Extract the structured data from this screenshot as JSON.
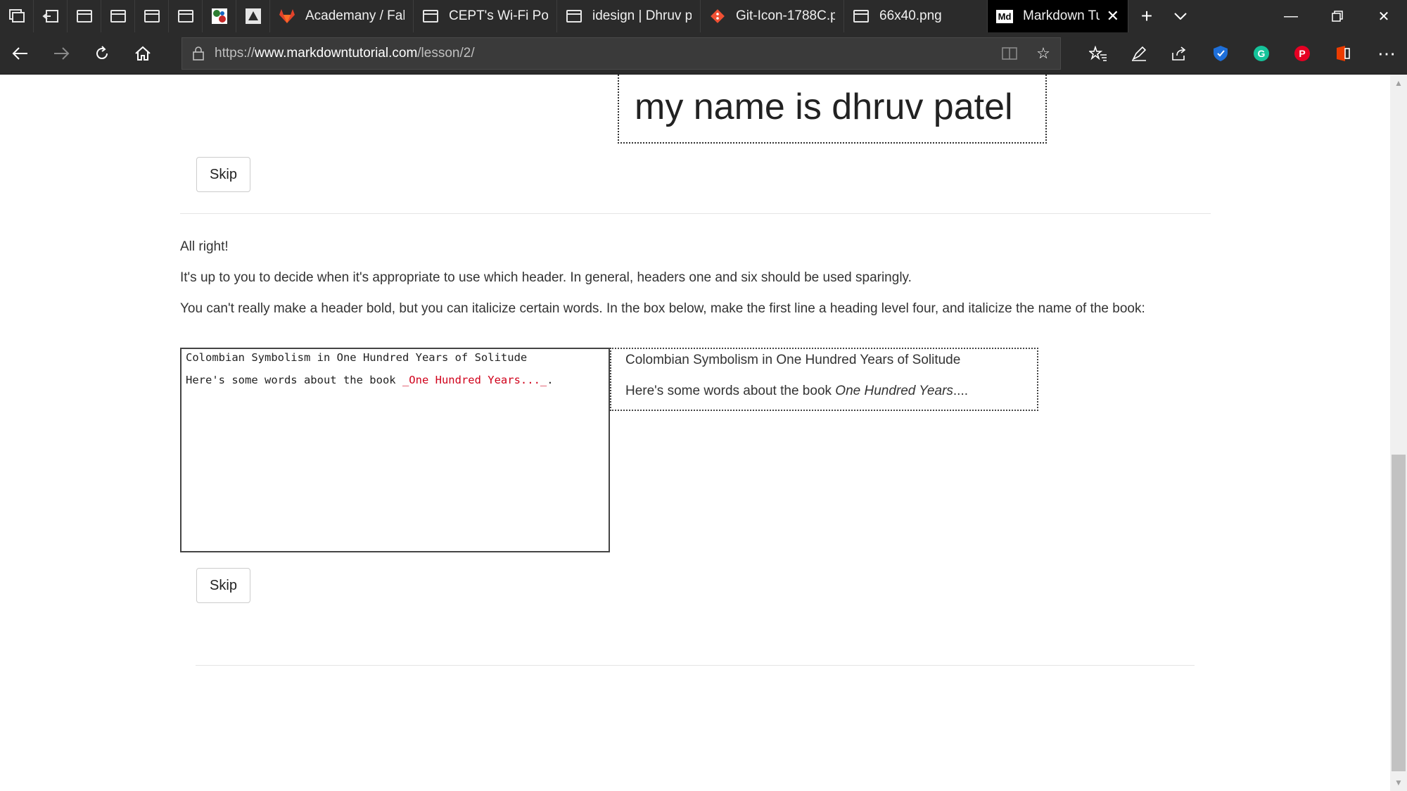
{
  "browser": {
    "tabs": [
      {
        "label": "Academany / Fab",
        "icon": "gitlab-icon",
        "active": false
      },
      {
        "label": "CEPT's Wi-Fi Port",
        "icon": "page-icon",
        "active": false
      },
      {
        "label": "idesign | Dhruv p",
        "icon": "page-icon",
        "active": false
      },
      {
        "label": "Git-Icon-1788C.p",
        "icon": "git-icon",
        "active": false
      },
      {
        "label": "66x40.png",
        "icon": "page-icon",
        "active": false
      },
      {
        "label": "Markdown Tu",
        "icon": "markdown-icon",
        "active": true
      }
    ],
    "markdown_favicon_text": "Md",
    "url_prefix": "https://",
    "url_host": "www.markdowntutorial.com",
    "url_path": "/lesson/2/",
    "accent_colors": {
      "gitlab": "#e2432a",
      "git": "#f05033",
      "grammarly": "#15c39a",
      "pinterest": "#e60023"
    }
  },
  "lesson": {
    "previous_result_text": "my name is dhruv patel",
    "skip_label_1": "Skip",
    "intro": "All right!",
    "paragraph_1": "It's up to you to decide when it's appropriate to use which header. In general, headers one and six should be used sparingly.",
    "paragraph_2": "You can't really make a header bold, but you can italicize certain words. In the box below, make the first line a heading level four, and italicize the name of the book:",
    "editor": {
      "line_1": "Colombian Symbolism in One Hundred Years of Solitude",
      "line_2_prefix": "Here's some words about the book ",
      "line_2_emphasis": "_One Hundred Years..._",
      "line_2_suffix": "."
    },
    "preview": {
      "line_1": "Colombian Symbolism in One Hundred Years of Solitude",
      "line_2_prefix": "Here's some words about the book ",
      "line_2_emphasis": "One Hundred Years",
      "line_2_suffix": "...."
    },
    "skip_label_2": "Skip"
  }
}
